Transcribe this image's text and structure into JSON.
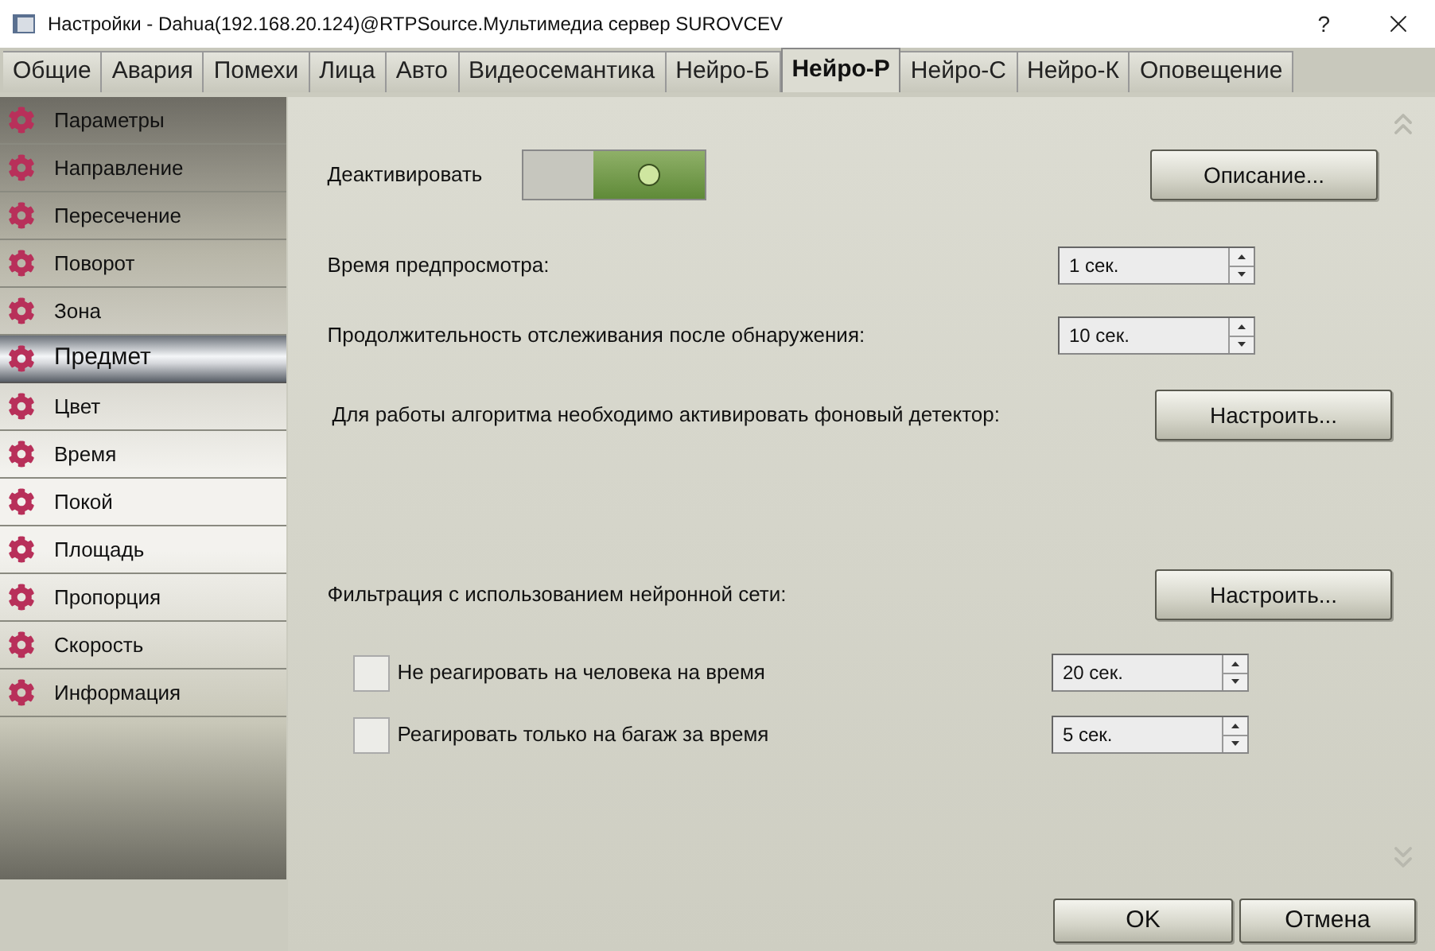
{
  "window": {
    "title": "Настройки - Dahua(192.168.20.124)@RTPSource.Мультимедиа сервер SUROVCEV",
    "help": "?"
  },
  "tabs": [
    {
      "label": "Общие",
      "selected": false
    },
    {
      "label": "Авария",
      "selected": false
    },
    {
      "label": "Помехи",
      "selected": false
    },
    {
      "label": "Лица",
      "selected": false
    },
    {
      "label": "Авто",
      "selected": false
    },
    {
      "label": "Видеосемантика",
      "selected": false
    },
    {
      "label": "Нейро-Б",
      "selected": false
    },
    {
      "label": "Нейро-Р",
      "selected": true
    },
    {
      "label": "Нейро-С",
      "selected": false
    },
    {
      "label": "Нейро-К",
      "selected": false
    },
    {
      "label": "Оповещение",
      "selected": false
    }
  ],
  "sidebar": {
    "items": [
      {
        "label": "Параметры",
        "selected": false
      },
      {
        "label": "Направление",
        "selected": false
      },
      {
        "label": "Пересечение",
        "selected": false
      },
      {
        "label": "Поворот",
        "selected": false
      },
      {
        "label": "Зона",
        "selected": false
      },
      {
        "label": "Предмет",
        "selected": true
      },
      {
        "label": "Цвет",
        "selected": false
      },
      {
        "label": "Время",
        "selected": false
      },
      {
        "label": "Покой",
        "selected": false
      },
      {
        "label": "Площадь",
        "selected": false
      },
      {
        "label": "Пропорция",
        "selected": false
      },
      {
        "label": "Скорость",
        "selected": false
      },
      {
        "label": "Информация",
        "selected": false
      }
    ]
  },
  "deactivate": {
    "label": "Деактивировать",
    "on": true,
    "button": "Описание..."
  },
  "preview_time": {
    "label": "Время предпросмотра:",
    "value": "1 сек."
  },
  "tracking_duration": {
    "label": "Продолжительность отслеживания после обнаружения:",
    "value": "10 сек."
  },
  "background_detector": {
    "label": "Для работы алгоритма необходимо активировать фоновый детектор:",
    "button": "Настроить..."
  },
  "neural_filter": {
    "label": "Фильтрация с использованием нейронной сети:",
    "button": "Настроить...",
    "options": [
      {
        "label": "Не реагировать на человека на время",
        "checked": false,
        "value": "20 сек."
      },
      {
        "label": "Реагировать только на багаж за время",
        "checked": false,
        "value": "5 сек."
      }
    ]
  },
  "footer": {
    "buttons": [
      "OK",
      "Отмена"
    ]
  }
}
